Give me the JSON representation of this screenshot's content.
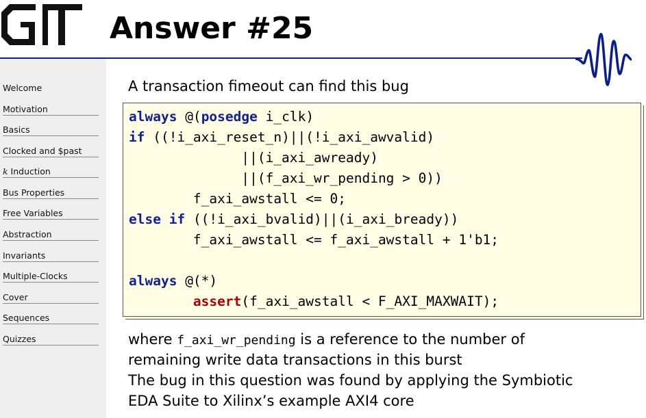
{
  "slide": {
    "title": "Answer #25",
    "intro": "A transaction fimeout can find this bug",
    "after": {
      "line1_pre": "where ",
      "line1_code": "f_axi_wr_pending",
      "line1_post": " is a reference to the number of",
      "line2": "remaining write data transactions in this burst",
      "line3": "The bug in this question was found by applying the Symbiotic",
      "line4": "EDA Suite to Xilinx’s example AXI4 core"
    }
  },
  "code": {
    "kw_always": "always",
    "kw_posedge": "posedge",
    "kw_if": "if",
    "kw_else": "else",
    "kw_assert": "assert",
    "l1_a": " @(",
    "l1_b": " i_clk)",
    "l2": " ((!i_axi_reset_n)||(!i_axi_awvalid)",
    "l3": "              ||(i_axi_awready)",
    "l4": "              ||(f_axi_wr_pending > 0))",
    "l5": "        f_axi_awstall <= 0;",
    "l6_sp": " ",
    "l6": " ((!i_axi_bvalid)||(i_axi_bready))",
    "l7": "        f_axi_awstall <= f_axi_awstall + 1'b1;",
    "l9": " @(*)",
    "l10_indent": "        ",
    "l10": "(f_axi_awstall < F_AXI_MAXWAIT);"
  },
  "sidebar": {
    "items": [
      {
        "label": "Welcome"
      },
      {
        "label": "Motivation"
      },
      {
        "label": "Basics"
      },
      {
        "label": "Clocked and $past"
      },
      {
        "label_k": "k",
        "label": " Induction"
      },
      {
        "label": "Bus Properties"
      },
      {
        "label": "Free Variables"
      },
      {
        "label": "Abstraction"
      },
      {
        "label": "Invariants"
      },
      {
        "label": "Multiple-Clocks"
      },
      {
        "label": "Cover"
      },
      {
        "label": "Sequences"
      },
      {
        "label": "Quizzes"
      }
    ]
  },
  "icons": {
    "logo": "gt-logo",
    "wave": "waveform-icon"
  },
  "colors": {
    "rule": "#0a1f8c",
    "keyword": "#10209a",
    "assert": "#b00000",
    "code_bg": "#fffde3",
    "sidebar_bg": "#efefef"
  }
}
